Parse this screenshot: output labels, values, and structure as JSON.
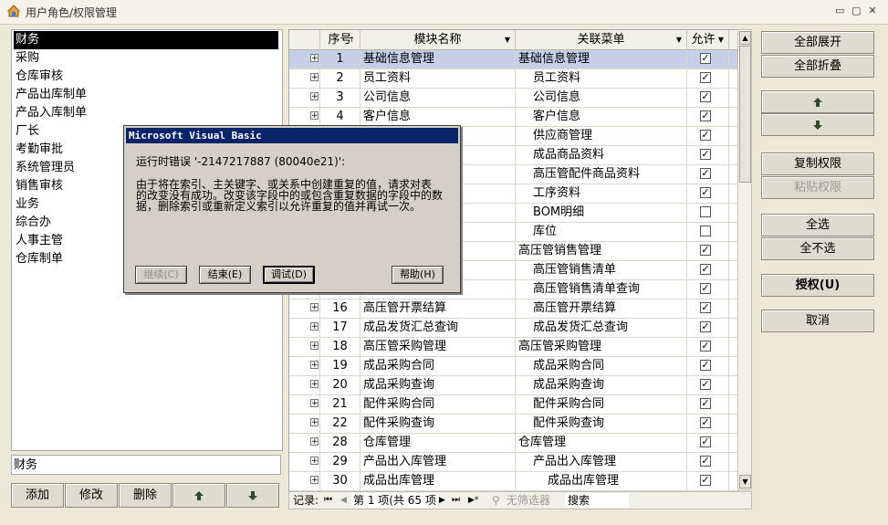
{
  "window": {
    "title": "用户角色/权限管理",
    "controls": {
      "minimize": "▭",
      "maximize": "▢",
      "close": "✕"
    }
  },
  "roles": {
    "items": [
      "财务",
      "采购",
      "仓库审核",
      "产品出库制单",
      "产品入库制单",
      "厂长",
      "考勤审批",
      "系统管理员",
      "销售审核",
      "业务",
      "综合办",
      "人事主管",
      "仓库制单"
    ],
    "selected": "财务",
    "edit_value": "财务",
    "buttons": {
      "add": "添加",
      "modify": "修改",
      "delete": "删除",
      "up_icon": "arrow-up-icon",
      "down_icon": "arrow-down-icon"
    }
  },
  "grid": {
    "headers": {
      "seq": "序号",
      "module": "模块名称",
      "menu": "关联菜单",
      "allow": "允许"
    },
    "rows": [
      {
        "seq": "1",
        "module": "基础信息管理",
        "menu": "基础信息管理",
        "level": 0,
        "checked": true,
        "selected": true
      },
      {
        "seq": "2",
        "module": "员工资料",
        "menu": "员工资料",
        "level": 1,
        "checked": true
      },
      {
        "seq": "3",
        "module": "公司信息",
        "menu": "公司信息",
        "level": 1,
        "checked": true
      },
      {
        "seq": "4",
        "module": "客户信息",
        "menu": "客户信息",
        "level": 1,
        "checked": true
      },
      {
        "seq": "",
        "module": "",
        "menu": "供应商管理",
        "level": 1,
        "checked": true
      },
      {
        "seq": "",
        "module": "",
        "menu": "成品商品资料",
        "level": 1,
        "checked": true
      },
      {
        "seq": "",
        "module": "料",
        "menu": "高压管配件商品资料",
        "level": 1,
        "checked": true
      },
      {
        "seq": "",
        "module": "",
        "menu": "工序资料",
        "level": 1,
        "checked": true
      },
      {
        "seq": "",
        "module": "",
        "menu": "BOM明细",
        "level": 1,
        "checked": false
      },
      {
        "seq": "",
        "module": "",
        "menu": "库位",
        "level": 1,
        "checked": false
      },
      {
        "seq": "",
        "module": "",
        "menu": "高压管销售管理",
        "level": 0,
        "checked": true
      },
      {
        "seq": "",
        "module": "",
        "menu": "高压管销售清单",
        "level": 1,
        "checked": true
      },
      {
        "seq": "",
        "module": "询",
        "menu": "高压管销售清单查询",
        "level": 1,
        "checked": true
      },
      {
        "seq": "16",
        "module": "高压管开票结算",
        "menu": "高压管开票结算",
        "level": 1,
        "checked": true
      },
      {
        "seq": "17",
        "module": "成品发货汇总查询",
        "menu": "成品发货汇总查询",
        "level": 1,
        "checked": true
      },
      {
        "seq": "18",
        "module": "高压管采购管理",
        "menu": "高压管采购管理",
        "level": 0,
        "checked": true
      },
      {
        "seq": "19",
        "module": "成品采购合同",
        "menu": "成品采购合同",
        "level": 1,
        "checked": true
      },
      {
        "seq": "20",
        "module": "成品采购查询",
        "menu": "成品采购查询",
        "level": 1,
        "checked": true
      },
      {
        "seq": "21",
        "module": "配件采购合同",
        "menu": "配件采购合同",
        "level": 1,
        "checked": true
      },
      {
        "seq": "22",
        "module": "配件采购查询",
        "menu": "配件采购查询",
        "level": 1,
        "checked": true
      },
      {
        "seq": "28",
        "module": "仓库管理",
        "menu": "仓库管理",
        "level": 0,
        "checked": true
      },
      {
        "seq": "29",
        "module": "产品出入库管理",
        "menu": "产品出入库管理",
        "level": 1,
        "checked": true
      },
      {
        "seq": "30",
        "module": "成品出库管理",
        "menu": "成品出库管理",
        "level": 2,
        "checked": true
      }
    ]
  },
  "navbar": {
    "record_label": "记录:",
    "first": "⏮",
    "prev": "◀",
    "position": "第 1 项(共 65 项",
    "next": "▶",
    "last": "⏭",
    "new": "▶*",
    "filter": "无筛选器",
    "search": "搜索"
  },
  "actions": {
    "expand_all": "全部展开",
    "collapse_all": "全部折叠",
    "copy_perm": "复制权限",
    "paste_perm": "粘贴权限",
    "select_all": "全选",
    "select_none": "全不选",
    "grant": "授权(U)",
    "cancel": "取消"
  },
  "dialog": {
    "title": "Microsoft Visual Basic",
    "error_line": "运行时错误 '-2147217887 (80040e21)':",
    "message_1": "由于将在索引、主关键字、或关系中创建重复的值，请求对表",
    "message_2": "的改变没有成功。改变该字段中的或包含重复数据的字段中的数",
    "message_3": "据，删除索引或重新定义索引以允许重复的值并再试一次。",
    "buttons": {
      "continue": "继续(C)",
      "end": "结束(E)",
      "debug": "调试(D)",
      "help": "帮助(H)"
    }
  }
}
